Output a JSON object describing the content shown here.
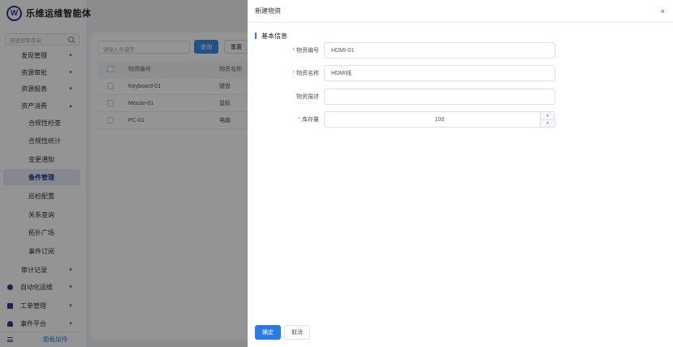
{
  "app": {
    "name": "乐维运维智能体",
    "logo_letter": "W"
  },
  "sidebar": {
    "search_placeholder": "快速搜索菜单",
    "items": [
      {
        "label": "发现管理",
        "chevron": "▾"
      },
      {
        "label": "资源审批",
        "chevron": "▾"
      },
      {
        "label": "资源报表",
        "chevron": "▾"
      },
      {
        "label": "资产消费",
        "chevron": "▴"
      },
      {
        "label": "合规性检查"
      },
      {
        "label": "合规性统计"
      },
      {
        "label": "变更通知"
      },
      {
        "label": "备件管理"
      },
      {
        "label": "巡检配置"
      },
      {
        "label": "关系查询"
      },
      {
        "label": "拓扑广场"
      },
      {
        "label": "事件订阅"
      },
      {
        "label": "审计记录",
        "chevron": "▾"
      },
      {
        "label": "自动化运维",
        "chevron": "▾"
      },
      {
        "label": "工单管理",
        "chevron": "▾"
      },
      {
        "label": "事件平台",
        "chevron": "▾"
      }
    ],
    "collapse_label": "面板加持"
  },
  "main": {
    "query_placeholder": "请输入关键字",
    "query_button": "查询",
    "reset_button": "重置",
    "table": {
      "columns": [
        "物资编号",
        "物资名称"
      ],
      "rows": [
        [
          "Keyboard-01",
          "键盘"
        ],
        [
          "Mouse-01",
          "鼠标"
        ],
        [
          "PC-01",
          "电脑"
        ]
      ]
    }
  },
  "drawer": {
    "title": "新建物资",
    "close": "×",
    "section_title": "基本信息",
    "fields": {
      "code": {
        "label": "物资编号",
        "value": "HDMI-01",
        "required": "*"
      },
      "name": {
        "label": "物资名称",
        "value": "HDMI线",
        "required": "*"
      },
      "desc": {
        "label": "物资描述",
        "value": ""
      },
      "stock": {
        "label": "库存量",
        "value": "100",
        "required": "*"
      }
    },
    "confirm_button": "确定",
    "cancel_button": "取消"
  }
}
